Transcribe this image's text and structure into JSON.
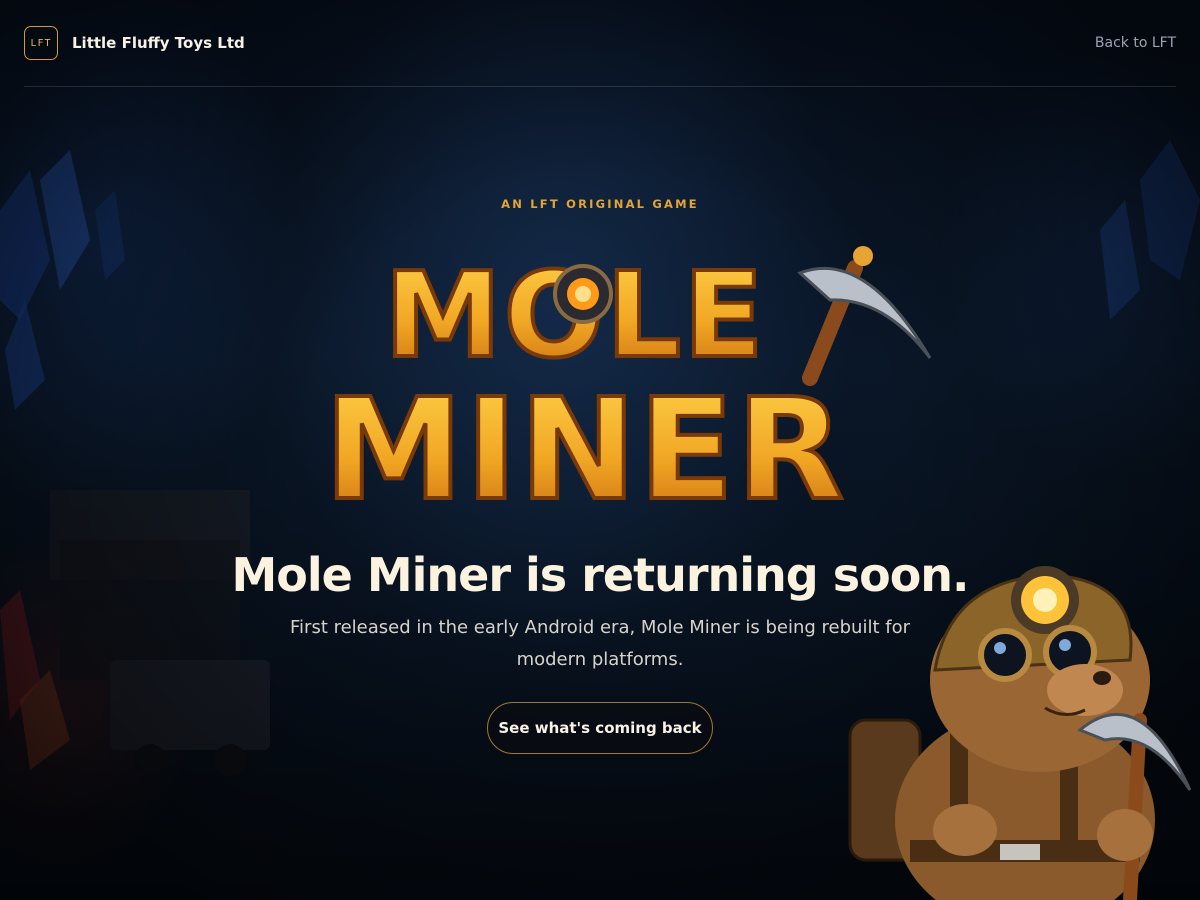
{
  "header": {
    "brand_badge": "LFT",
    "brand_name": "Little Fluffy Toys Ltd",
    "back_link": "Back to LFT"
  },
  "hero": {
    "eyebrow": "AN LFT ORIGINAL GAME",
    "logo_line1": "MOLE",
    "logo_line2": "MINER",
    "headline": "Mole Miner is returning soon.",
    "subtext": "First released in the early Android era, Mole Miner is being rebuilt for modern platforms.",
    "cta_label": "See what's coming back"
  },
  "colors": {
    "accent": "#e6a533",
    "logo_gold": "#f1a724",
    "background": "#07101f"
  },
  "icons": {
    "mascot": "mole-miner-mascot",
    "pickaxe": "pickaxe-icon"
  }
}
